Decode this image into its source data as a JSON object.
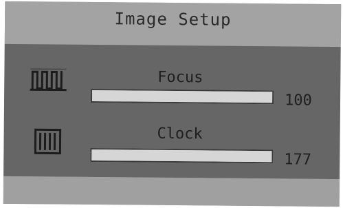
{
  "window": {
    "title": "Image Setup"
  },
  "settings": [
    {
      "label": "Focus",
      "value": "100",
      "level_percent": 100,
      "icon": "focus-waveform-icon"
    },
    {
      "label": "Clock",
      "value": "177",
      "level_percent": 100,
      "icon": "clock-bars-icon"
    }
  ],
  "colors": {
    "panel_bg": "#666666",
    "title_bg": "#a3a3a3",
    "track_bg": "#cfcfcf",
    "text": "#1f1f1f"
  }
}
